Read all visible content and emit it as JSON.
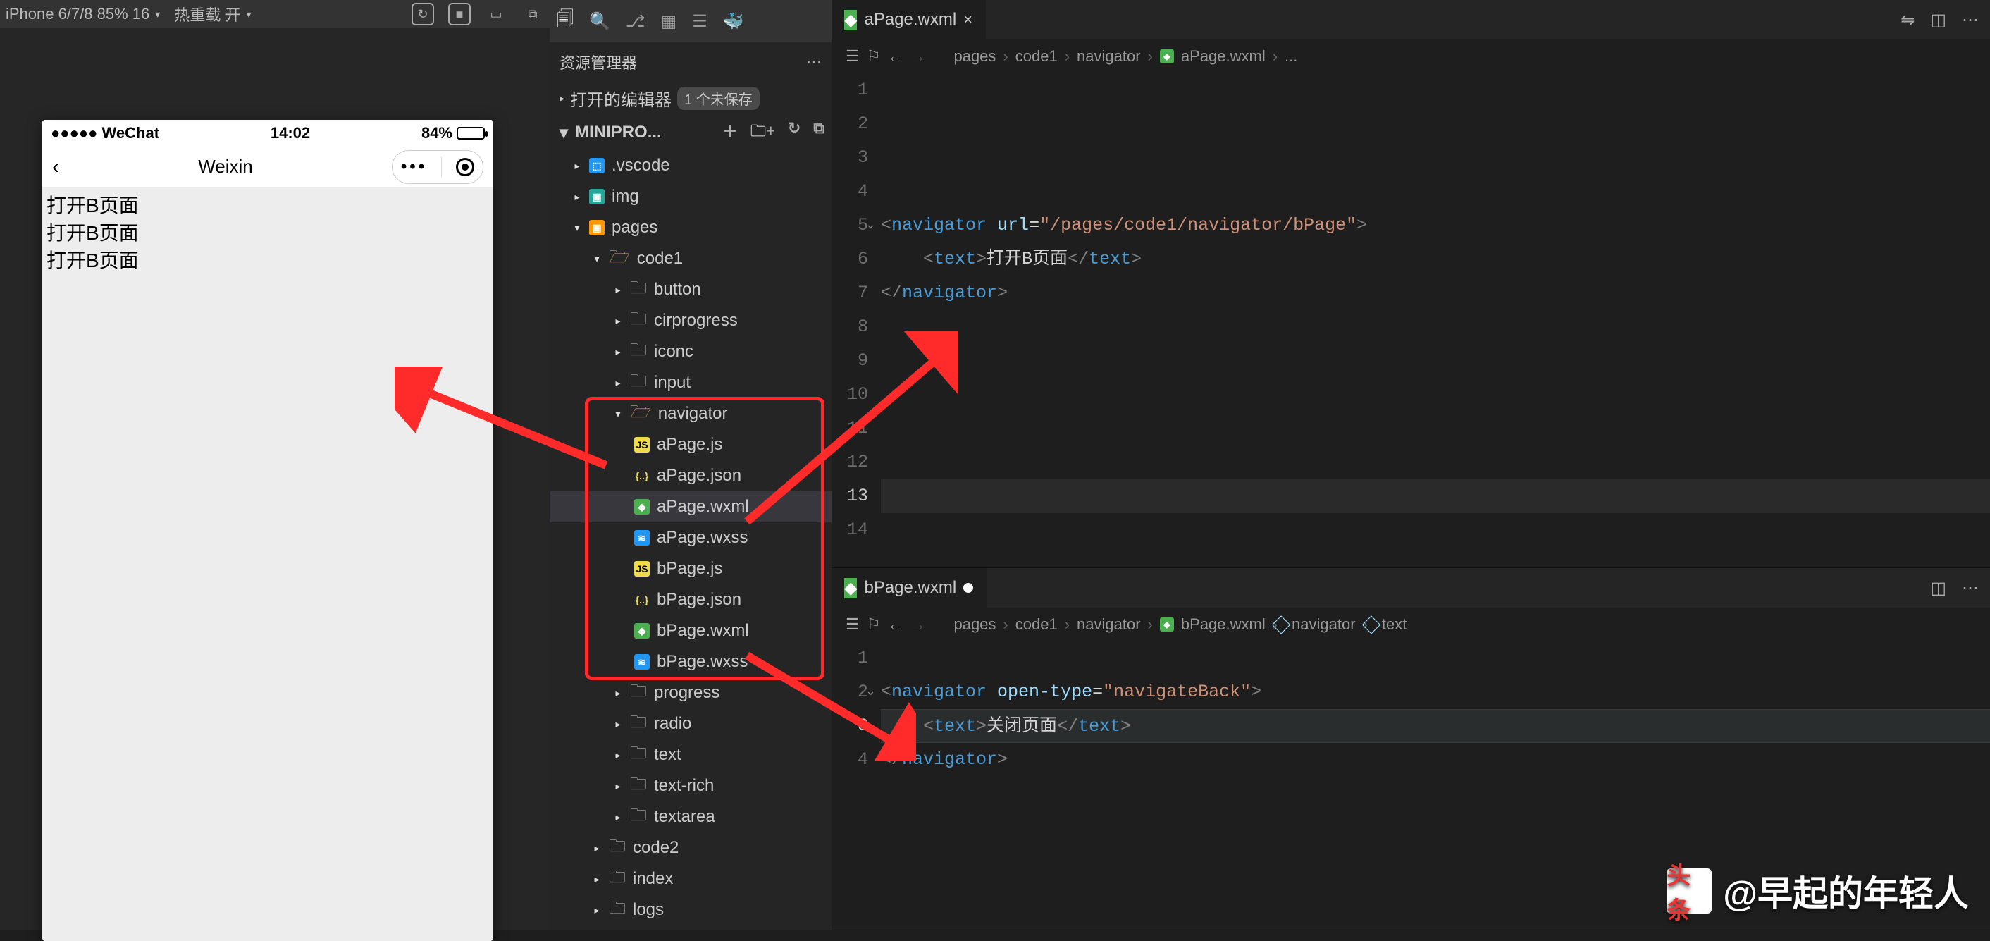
{
  "sim": {
    "device": "iPhone 6/7/8 85% 16",
    "hot_reload": "热重载 开",
    "status_left": "●●●●● WeChat",
    "status_time": "14:02",
    "status_batt": "84%",
    "nav_title": "Weixin",
    "body_lines": [
      "打开B页面",
      "打开B页面",
      "打开B页面"
    ]
  },
  "sidebar": {
    "title": "资源管理器",
    "open_editors": "打开的编辑器",
    "unsaved_badge": "1 个未保存",
    "project": "MINIPRO...",
    "tree": {
      "vscode": ".vscode",
      "img": "img",
      "pages": "pages",
      "code1": "code1",
      "button": "button",
      "cirprogress": "cirprogress",
      "iconc": "iconc",
      "input": "input",
      "navigator": "navigator",
      "aPage_js": "aPage.js",
      "aPage_json": "aPage.json",
      "aPage_wxml": "aPage.wxml",
      "aPage_wxss": "aPage.wxss",
      "bPage_js": "bPage.js",
      "bPage_json": "bPage.json",
      "bPage_wxml": "bPage.wxml",
      "bPage_wxss": "bPage.wxss",
      "progress": "progress",
      "radio": "radio",
      "text": "text",
      "text_rich": "text-rich",
      "textarea": "textarea",
      "code2": "code2",
      "index": "index",
      "logs": "logs"
    }
  },
  "tabs": {
    "a": "aPage.wxml",
    "b": "bPage.wxml"
  },
  "crumbs": {
    "a": [
      "pages",
      "code1",
      "navigator",
      "aPage.wxml",
      "..."
    ],
    "b": [
      "pages",
      "code1",
      "navigator",
      "bPage.wxml",
      "navigator",
      "text"
    ]
  },
  "codeA": {
    "lines": [
      1,
      2,
      3,
      4,
      5,
      6,
      7,
      8,
      9,
      10,
      11,
      12,
      13,
      14
    ],
    "l5_pre": "<",
    "l5_tag": "navigator",
    "l5_attr": " url",
    "l5_eq": "=",
    "l5_str": "\"/pages/code1/navigator/bPage\"",
    "l5_end": ">",
    "l6_pre": "    <",
    "l6_tag": "text",
    "l6_gt": ">",
    "l6_txt": "打开B页面",
    "l6_ct": "</",
    "l6_ctag": "text",
    "l6_ce": ">",
    "l7_pre": "</",
    "l7_tag": "navigator",
    "l7_end": ">"
  },
  "codeB": {
    "lines": [
      1,
      2,
      3,
      4
    ],
    "l2_pre": "<",
    "l2_tag": "navigator",
    "l2_attr": " open-type",
    "l2_eq": "=",
    "l2_str": "\"navigateBack\"",
    "l2_end": ">",
    "l3_pre": "    <",
    "l3_tag": "text",
    "l3_gt": ">",
    "l3_txt": "关闭页面",
    "l3_ct": "</",
    "l3_ctag": "text",
    "l3_ce": ">",
    "l4_pre": "</",
    "l4_tag": "navigator",
    "l4_end": ">"
  },
  "watermark": "@早起的年轻人",
  "watermark_logo": "头条"
}
